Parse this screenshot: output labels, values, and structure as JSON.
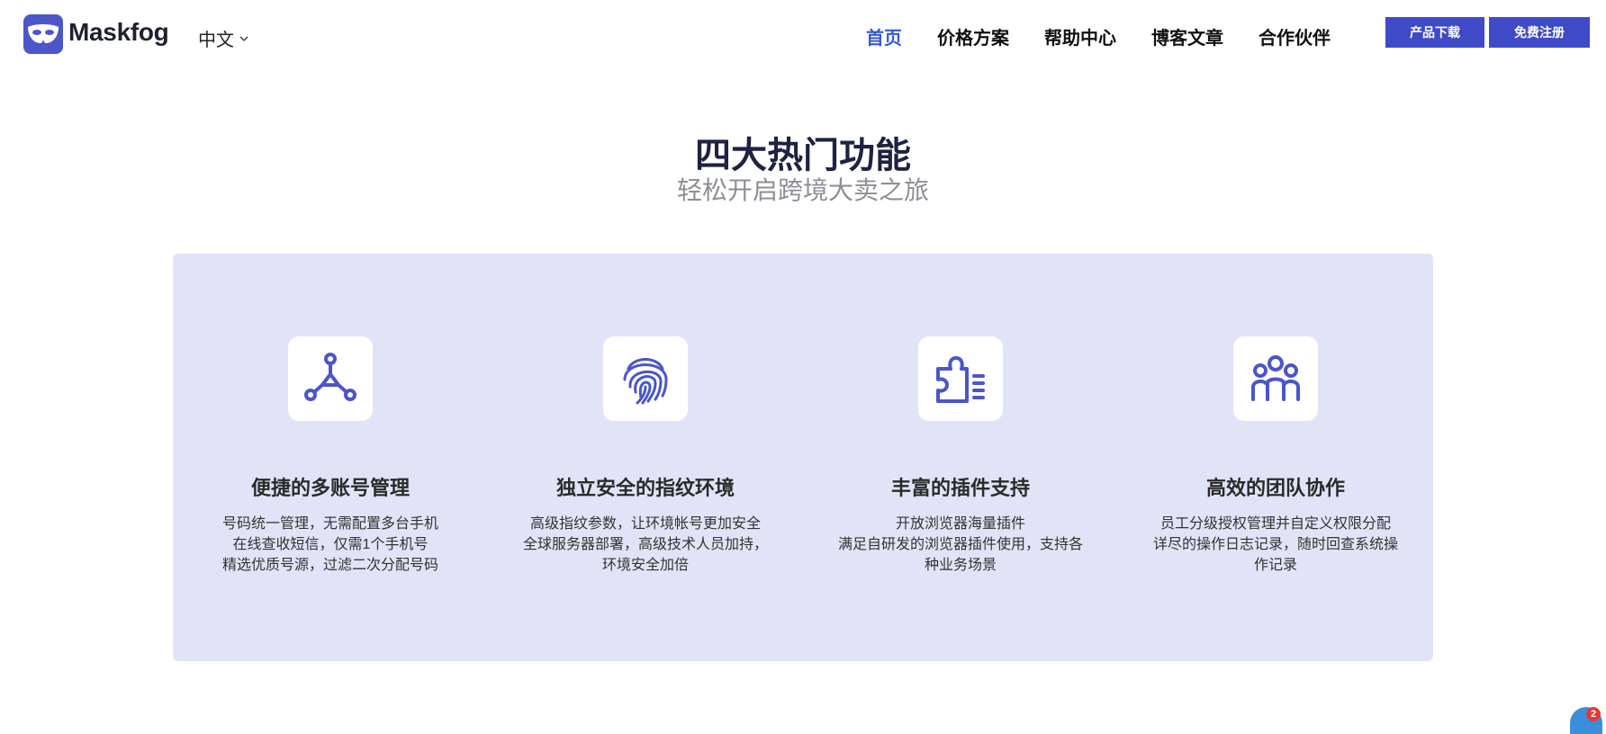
{
  "header": {
    "brand": "Maskfog",
    "language": "中文",
    "nav": [
      {
        "label": "首页",
        "active": true
      },
      {
        "label": "价格方案",
        "active": false
      },
      {
        "label": "帮助中心",
        "active": false
      },
      {
        "label": "博客文章",
        "active": false
      },
      {
        "label": "合作伙伴",
        "active": false
      }
    ],
    "download_button": "产品下载",
    "register_button": "免费注册"
  },
  "hero": {
    "title": "四大热门功能",
    "subtitle": "轻松开启跨境大卖之旅"
  },
  "features": [
    {
      "icon": "network-nodes-icon",
      "title": "便捷的多账号管理",
      "lines": [
        "号码统一管理，无需配置多台手机",
        "在线查收短信，仅需1个手机号",
        "精选优质号源，过滤二次分配号码"
      ]
    },
    {
      "icon": "fingerprint-icon",
      "title": "独立安全的指纹环境",
      "lines": [
        "高级指纹参数，让环境帐号更加安全",
        "全球服务器部署，高级技术人员加持，",
        "环境安全加倍"
      ]
    },
    {
      "icon": "puzzle-plugin-icon",
      "title": "丰富的插件支持",
      "lines": [
        "开放浏览器海量插件",
        "满足自研发的浏览器插件使用，支持各",
        "种业务场景"
      ]
    },
    {
      "icon": "team-icon",
      "title": "高效的团队协作",
      "lines": [
        "员工分级授权管理并自定义权限分配",
        "详尽的操作日志记录，随时回查系统操",
        "作记录"
      ]
    }
  ],
  "chat_widget": {
    "icon": "chat-icon",
    "badge": "2"
  },
  "colors": {
    "accent": "#3f4bc6",
    "nav_active": "#3358d8",
    "panel_bg": "#e1e4f6",
    "icon_color": "#4b56c8"
  }
}
